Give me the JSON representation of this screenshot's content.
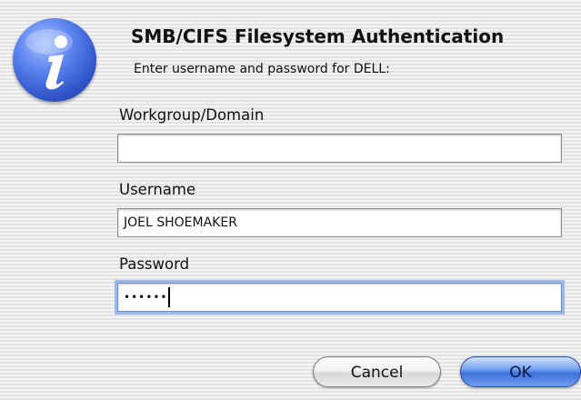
{
  "dialog": {
    "icon": "info-icon",
    "title": "SMB/CIFS Filesystem Authentication",
    "message": "Enter username and password for DELL:"
  },
  "fields": {
    "workgroup": {
      "label": "Workgroup/Domain",
      "value": ""
    },
    "username": {
      "label": "Username",
      "value": "JOEL SHOEMAKER"
    },
    "password": {
      "label": "Password",
      "masked_value": "••••••"
    }
  },
  "buttons": {
    "cancel_label": "Cancel",
    "ok_label": "OK"
  },
  "colors": {
    "accent": "#3e72d8",
    "focus_ring": "#9cb7e8"
  }
}
